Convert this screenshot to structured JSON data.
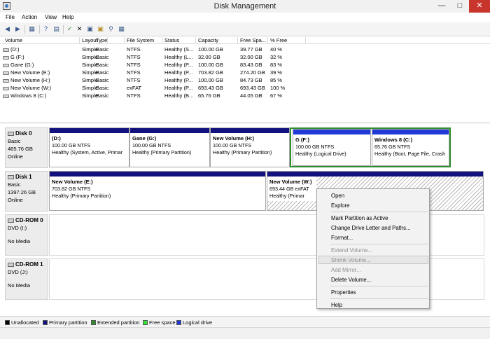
{
  "window": {
    "title": "Disk Management"
  },
  "menu": [
    "File",
    "Action",
    "View",
    "Help"
  ],
  "volume_table": {
    "columns": [
      "Volume",
      "Layout",
      "Type",
      "File System",
      "Status",
      "Capacity",
      "Free Spa...",
      "% Free"
    ],
    "rows": [
      [
        "(D:)",
        "Simple",
        "Basic",
        "NTFS",
        "Healthy (S...",
        "100.00 GB",
        "39.77 GB",
        "40 %"
      ],
      [
        "G (F:)",
        "Simple",
        "Basic",
        "NTFS",
        "Healthy (L...",
        "32.00 GB",
        "32.00 GB",
        "32 %"
      ],
      [
        "Gane (G:)",
        "Simple",
        "Basic",
        "NTFS",
        "Healthy (P...",
        "100.00 GB",
        "83.43 GB",
        "83 %"
      ],
      [
        "New Volume (E:)",
        "Simple",
        "Basic",
        "NTFS",
        "Healthy (P...",
        "703.82 GB",
        "274.20 GB",
        "39 %"
      ],
      [
        "New Volume (H:)",
        "Simple",
        "Basic",
        "NTFS",
        "Healthy (P...",
        "100.00 GB",
        "84.73 GB",
        "85 %"
      ],
      [
        "New Volume (W:)",
        "Simple",
        "Basic",
        "exFAT",
        "Healthy (P...",
        "693.43 GB",
        "693.43 GB",
        "100 %"
      ],
      [
        "Windows 8 (C:)",
        "Simple",
        "Basic",
        "NTFS",
        "Healthy (B...",
        "65.76 GB",
        "44.05 GB",
        "67 %"
      ]
    ]
  },
  "disks": {
    "disk0": {
      "label": [
        "Disk 0",
        "Basic",
        "465.76 GB",
        "Online"
      ],
      "partitions": [
        {
          "name": "(D:)",
          "size": "100.00 GB NTFS",
          "status": "Healthy (System, Active, Primar"
        },
        {
          "name": "Gane  (G:)",
          "size": "100.00 GB NTFS",
          "status": "Healthy (Primary Partition)"
        },
        {
          "name": "New Volume  (H:)",
          "size": "100.00 GB NTFS",
          "status": "Healthy (Primary Partition)"
        },
        {
          "name": "G  (F:)",
          "size": "100.00 GB NTFS",
          "status": "Healthy (Logical Drive)"
        },
        {
          "name": "Windows 8  (C:)",
          "size": "65.76 GB NTFS",
          "status": "Healthy (Boot, Page File, Crash"
        }
      ]
    },
    "disk1": {
      "label": [
        "Disk 1",
        "Basic",
        "1397.26 GB",
        "Online"
      ],
      "partitions": [
        {
          "name": "New Volume  (E:)",
          "size": "703.82 GB NTFS",
          "status": "Healthy (Primary Partition)"
        },
        {
          "name": "New Volume  (W:)",
          "size": "693.44 GB exFAT",
          "status": "Healthy (Primar"
        }
      ]
    },
    "cdrom0": {
      "label": [
        "CD-ROM 0",
        "DVD (I:)",
        "No Media"
      ]
    },
    "cdrom1": {
      "label": [
        "CD-ROM 1",
        "DVD (J:)",
        "No Media"
      ]
    }
  },
  "context_menu": {
    "items": [
      "Open",
      "Explore",
      "Mark Partition as Active",
      "Change Drive Letter and Paths...",
      "Format...",
      "Extend Volume...",
      "Shrink Volume...",
      "Add Mirror...",
      "Delete Volume...",
      "Properties",
      "Help"
    ]
  },
  "legend": {
    "items": [
      "Unallocated",
      "Primary partition",
      "Extended partition",
      "Free space",
      "Logical drive"
    ],
    "colors": [
      "#000000",
      "#12127e",
      "#2f8f2f",
      "#33e633",
      "#1f3ad6"
    ]
  }
}
